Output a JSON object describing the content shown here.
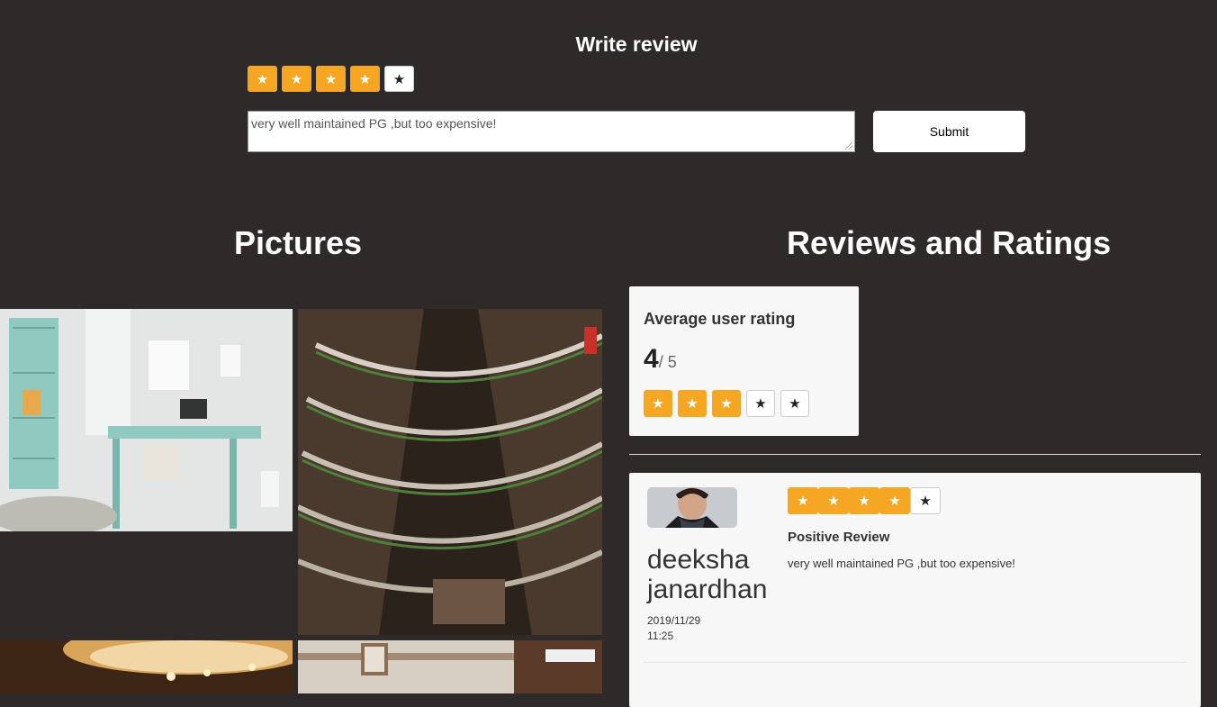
{
  "write_review": {
    "title": "Write review",
    "rating": 4,
    "max": 5,
    "text": "very well maintained PG ,but too expensive!",
    "submit_label": "Submit"
  },
  "sections": {
    "pictures_title": "Pictures",
    "reviews_title": "Reviews and Ratings"
  },
  "average": {
    "label": "Average user rating",
    "value": "4",
    "suffix": "/ 5",
    "stars_filled": 3,
    "stars_total": 5
  },
  "reviews": [
    {
      "name": "deeksha janardhan",
      "date": "2019/11/29 11:25",
      "stars_filled": 4,
      "stars_total": 5,
      "headline": "Positive Review",
      "text": "very well maintained PG ,but too expensive!"
    }
  ],
  "icons": {
    "star": "★"
  },
  "colors": {
    "background": "#2d2a29",
    "star_on": "#f5a623",
    "card": "#f7f7f7"
  }
}
